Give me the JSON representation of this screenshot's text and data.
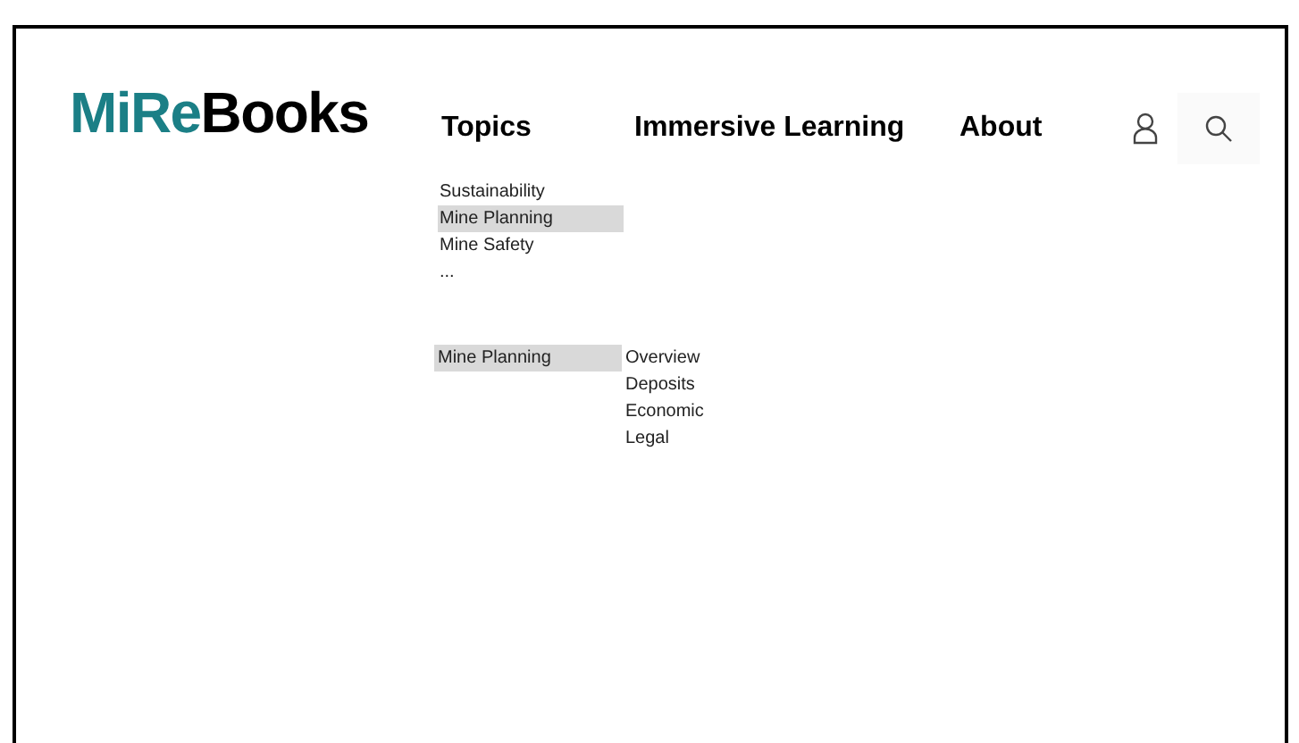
{
  "logo": {
    "accent": "MiRe",
    "rest": "Books"
  },
  "nav": [
    {
      "label": "Topics"
    },
    {
      "label": "Immersive Learning"
    },
    {
      "label": "About"
    }
  ],
  "topics_menu": [
    {
      "label": "Sustainability",
      "selected": false
    },
    {
      "label": "Mine Planning",
      "selected": true
    },
    {
      "label": "Mine Safety",
      "selected": false
    },
    {
      "label": "...",
      "selected": false
    }
  ],
  "submenu": {
    "parent": {
      "label": "Mine Planning",
      "selected": true
    },
    "items": [
      {
        "label": "Overview"
      },
      {
        "label": "Deposits"
      },
      {
        "label": "Economic"
      },
      {
        "label": "Legal"
      }
    ]
  }
}
